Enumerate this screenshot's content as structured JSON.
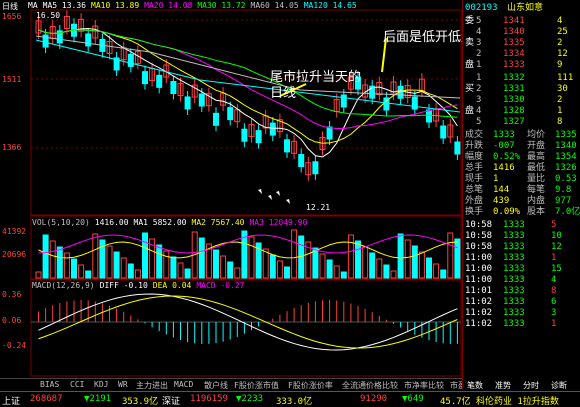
{
  "header": {
    "tab_title": "日线",
    "ma_line": [
      "MA",
      "MA5 13.36",
      "MA10 13.89",
      "MA20 14.08",
      "MA30 13.72",
      "MA60 14.05",
      "MA120 14.65"
    ],
    "vol_line": [
      "VOL(5,10,20)",
      "1416.00",
      "MA1 5852.00",
      "MA2 7567.40",
      "MA3 12049.90"
    ],
    "macd_line": [
      "MACD(12,26,9)",
      "DIFF -0.10",
      "DEA 0.04",
      "MACD -0.27"
    ]
  },
  "price_axis": [
    "1656",
    "1511",
    "1366"
  ],
  "vol_axis": [
    "41392",
    "20696"
  ],
  "macd_axis": [
    "0.36",
    "0.06",
    "-0.24"
  ],
  "price_labels": {
    "high": "16.50",
    "low": "12.21"
  },
  "annotations": {
    "tail_rise": [
      "尾市拉升当天的",
      "日线"
    ],
    "then_low_open": "后面是低开低走"
  },
  "bottom_tabs": [
    "BIAS",
    "CCI",
    "KDJ",
    "WR",
    "主力进出",
    "MACD",
    "散户线",
    "F股价涨市值",
    "F股价涨价率",
    "全流通价格比较",
    "市净率比较",
    "市盈率比较"
  ],
  "panel_buttons": [
    "笔数",
    "准势",
    "分时",
    "诊断"
  ],
  "quote": {
    "code": "002193",
    "name": "山东如意",
    "sell": [
      {
        "label": "5",
        "price": "1341",
        "vol": "4"
      },
      {
        "label": "4",
        "price": "1340",
        "vol": "25"
      },
      {
        "label": "3",
        "price": "1335",
        "vol": "2"
      },
      {
        "label": "2",
        "price": "1334",
        "vol": "12"
      },
      {
        "label": "1",
        "price": "1333",
        "vol": "9"
      }
    ],
    "buy": [
      {
        "label": "1",
        "price": "1332",
        "vol": "111"
      },
      {
        "label": "2",
        "price": "1331",
        "vol": "30"
      },
      {
        "label": "3",
        "price": "1330",
        "vol": "2"
      },
      {
        "label": "4",
        "price": "1328",
        "vol": "1"
      },
      {
        "label": "5",
        "price": "1327",
        "vol": "8"
      }
    ],
    "side_labels": [
      "委",
      "卖",
      "盘",
      "买",
      "盘"
    ],
    "stats": [
      {
        "k": "成交",
        "v": "1333",
        "k2": "均价",
        "v2": "1335"
      },
      {
        "k": "升跌",
        "v": "-007",
        "k2": "开盘",
        "v2": "1340"
      },
      {
        "k": "幅度",
        "v": "0.52%",
        "k2": "最高",
        "v2": "1354"
      },
      {
        "k": "总手",
        "v": "1416",
        "k2": "最低",
        "v2": "1326"
      },
      {
        "k": "现手",
        "v": "1",
        "k2": "量比",
        "v2": "0.53"
      },
      {
        "k": "总笔",
        "v": "144",
        "k2": "每笔",
        "v2": "9.8"
      },
      {
        "k": "外盘",
        "v": "439",
        "k2": "内盘",
        "v2": "977"
      },
      {
        "k": "换手",
        "v": "0.09%",
        "k2": "股本",
        "v2": "7.0亿"
      }
    ],
    "ticks": [
      {
        "t": "10:58",
        "p": "1333",
        "v": "5"
      },
      {
        "t": "10:58",
        "p": "1333",
        "v": "10"
      },
      {
        "t": "10:58",
        "p": "1333",
        "v": "12"
      },
      {
        "t": "11:00",
        "p": "1333",
        "v": "1"
      },
      {
        "t": "11:00",
        "p": "1333",
        "v": "15"
      },
      {
        "t": "11:00",
        "p": "1333",
        "v": "4"
      },
      {
        "t": "11:01",
        "p": "1333",
        "v": "8"
      },
      {
        "t": "11:02",
        "p": "1333",
        "v": "6"
      },
      {
        "t": "11:02",
        "p": "1333",
        "v": "3"
      },
      {
        "t": "11:02",
        "p": "1333",
        "v": "1"
      }
    ]
  },
  "status": {
    "sh_label": "上证",
    "sh_index": "268687",
    "sh_change": "▼2191",
    "sh_amount": "353.9亿",
    "sz_label": "深证",
    "sz_index": "1196159",
    "sz_change": "▼2233",
    "sz_amount": "333.0亿",
    "misc": "91290",
    "misc2": "▼649",
    "misc3": "45.7亿",
    "right": "科伦药业 1拉升指数"
  }
}
